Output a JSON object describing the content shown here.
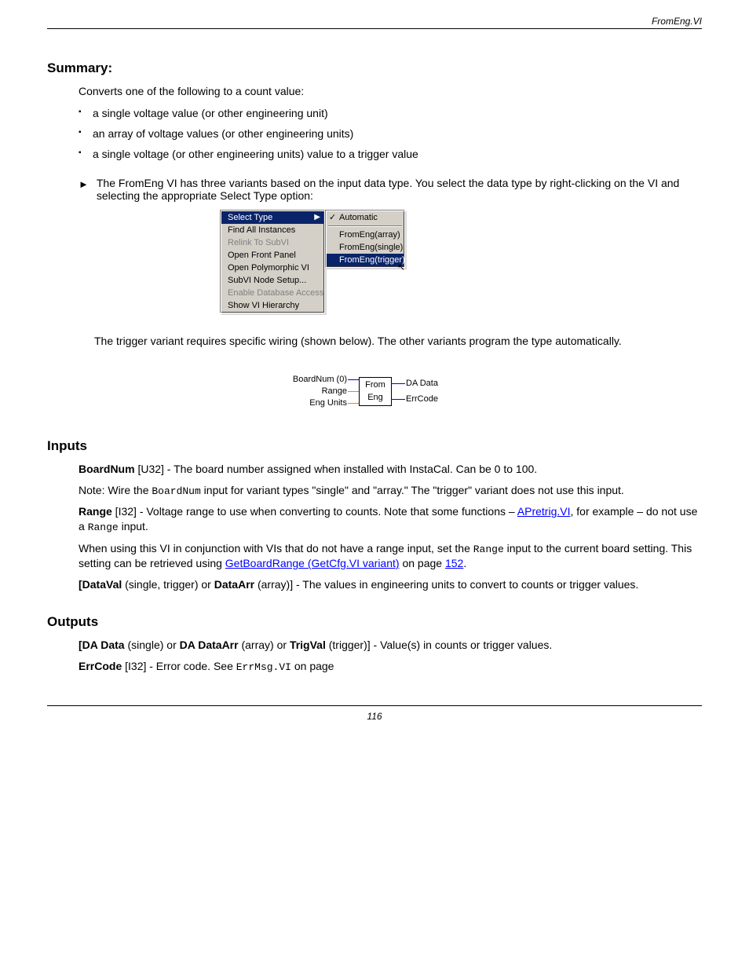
{
  "header": {
    "left": "",
    "right": "FromEng.VI"
  },
  "footer": {
    "page": "116"
  },
  "summary": {
    "intro": "Converts one of the following to a count value:",
    "bullets": [
      "a single voltage value (or other engineering unit)",
      "an array of voltage values (or other engineering units)",
      "a single voltage (or other engineering units) value to a trigger value"
    ],
    "variant_note": "The FromEng VI has three variants based on the input data type. You select the data type by right-clicking on the VI and selecting the appropriate Select Type option:"
  },
  "context_menu": {
    "items": [
      {
        "label": "Select Type",
        "highlight": true,
        "hasArrow": true
      },
      {
        "label": "Find All Instances"
      },
      {
        "label": "Relink To SubVI",
        "disabled": true
      },
      {
        "label": "Open Front Panel"
      },
      {
        "label": "Open Polymorphic VI"
      },
      {
        "label": "SubVI Node Setup..."
      },
      {
        "label": "Enable Database Access",
        "disabled": true
      },
      {
        "label": "Show VI Hierarchy"
      }
    ],
    "sub_items": [
      {
        "label": "Automatic",
        "checked": true
      },
      {
        "label": "FromEng(array)"
      },
      {
        "label": "FromEng(single)"
      },
      {
        "label": "FromEng(trigger)",
        "highlight": true
      }
    ]
  },
  "variant_wire": "The trigger variant requires specific wiring (shown below). The other variants program the type automatically.",
  "vi": {
    "left": [
      "BoardNum (0)",
      "Range",
      "Eng Units"
    ],
    "box_line1": "From",
    "box_line2": "Eng",
    "right": [
      "DA Data",
      "ErrCode"
    ]
  },
  "inputs": {
    "title": "Inputs",
    "board": {
      "label": "BoardNum",
      "before": " [U32] - The board number assigned when installed with InstaCal. Can be 0 to 100.",
      "code": "BoardNum",
      "after": " input for variant types \"single\" and \"array.\" The \"trigger\" variant does not use this input."
    },
    "range": {
      "label": "Range",
      "text1_before": " [I32] - Voltage range to use when converting to counts. Note that some functions – ",
      "text1_link": "APretrig.VI",
      "text1_after": ", for example – do not use a ",
      "text1_code": "Range",
      "text1_tail": " input.",
      "text2_before": "When using this VI in conjunction with VIs that do not have a range input, set the ",
      "text2_code": "Range",
      "text2_mid": " input to the current board setting. This setting can be retrieved using ",
      "text2_link": "GetBoardRange (GetCfg.VI variant)",
      "text2_after": " on page ",
      "text2_page": "152",
      "text2_tail": "."
    },
    "dataval": {
      "label": "[DataVal",
      "text": " (single, trigger) or ",
      "label2": "DataArr",
      "text2": " (array)] - The values in engineering units to convert to counts or trigger values."
    }
  },
  "outputs": {
    "title": "Outputs",
    "dadata": {
      "label": "[DA Data",
      "text": " (single) or ",
      "label2": "DA DataArr",
      "text2": " (array) or ",
      "label3": "TrigVal",
      "text3": " (trigger)] - Value(s) in counts or trigger values."
    },
    "errcode": {
      "label": "ErrCode",
      "text_before": " [I32] - Error code. See ",
      "code": "ErrMsg.VI",
      "text_after": " on page "
    }
  }
}
